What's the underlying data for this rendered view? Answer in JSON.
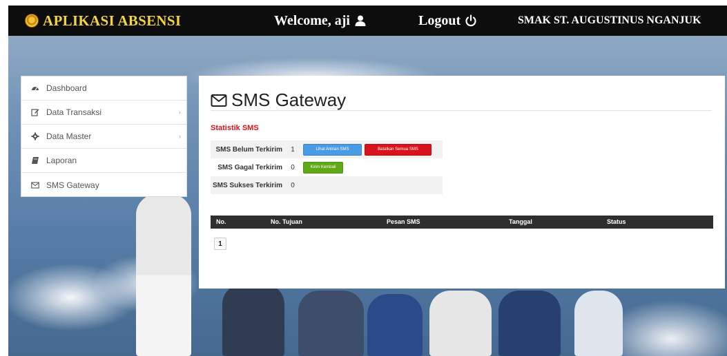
{
  "header": {
    "app_title": "APLIKASI ABSENSI",
    "welcome": "Welcome, aji",
    "logout": "Logout",
    "school": "SMAK ST. AUGUSTINUS NGANJUK"
  },
  "sidebar": {
    "items": [
      {
        "label": "Dashboard",
        "icon": "dashboard-icon"
      },
      {
        "label": "Data Transaksi",
        "icon": "edit-icon",
        "has_children": true
      },
      {
        "label": "Data Master",
        "icon": "gear-icon",
        "has_children": true
      },
      {
        "label": "Laporan",
        "icon": "book-icon"
      },
      {
        "label": "SMS Gateway",
        "icon": "envelope-icon"
      }
    ]
  },
  "main": {
    "title": "SMS Gateway",
    "stats_heading": "Statistik SMS",
    "stats": [
      {
        "label": "SMS Belum Terkirim",
        "value": "1",
        "buttons": [
          "Lihat Antrian SMS",
          "Batalkan Semua SMS"
        ]
      },
      {
        "label": "SMS Gagal Terkirim",
        "value": "0",
        "buttons": [
          "Kirim Kembali"
        ]
      },
      {
        "label": "SMS Sukses Terkirim",
        "value": "0",
        "buttons": []
      }
    ],
    "table": {
      "columns": [
        "No.",
        "No. Tujuan",
        "Pesan SMS",
        "Tanggal",
        "Status"
      ],
      "rows": []
    },
    "pager": {
      "current_page": "1"
    }
  },
  "colors": {
    "header_bg": "#0d0d0d",
    "brand_yellow": "#f4d53a",
    "accent_red": "#e3121b",
    "button_blue": "#4a9be6",
    "button_red": "#d9131d",
    "button_green": "#5faa16"
  }
}
